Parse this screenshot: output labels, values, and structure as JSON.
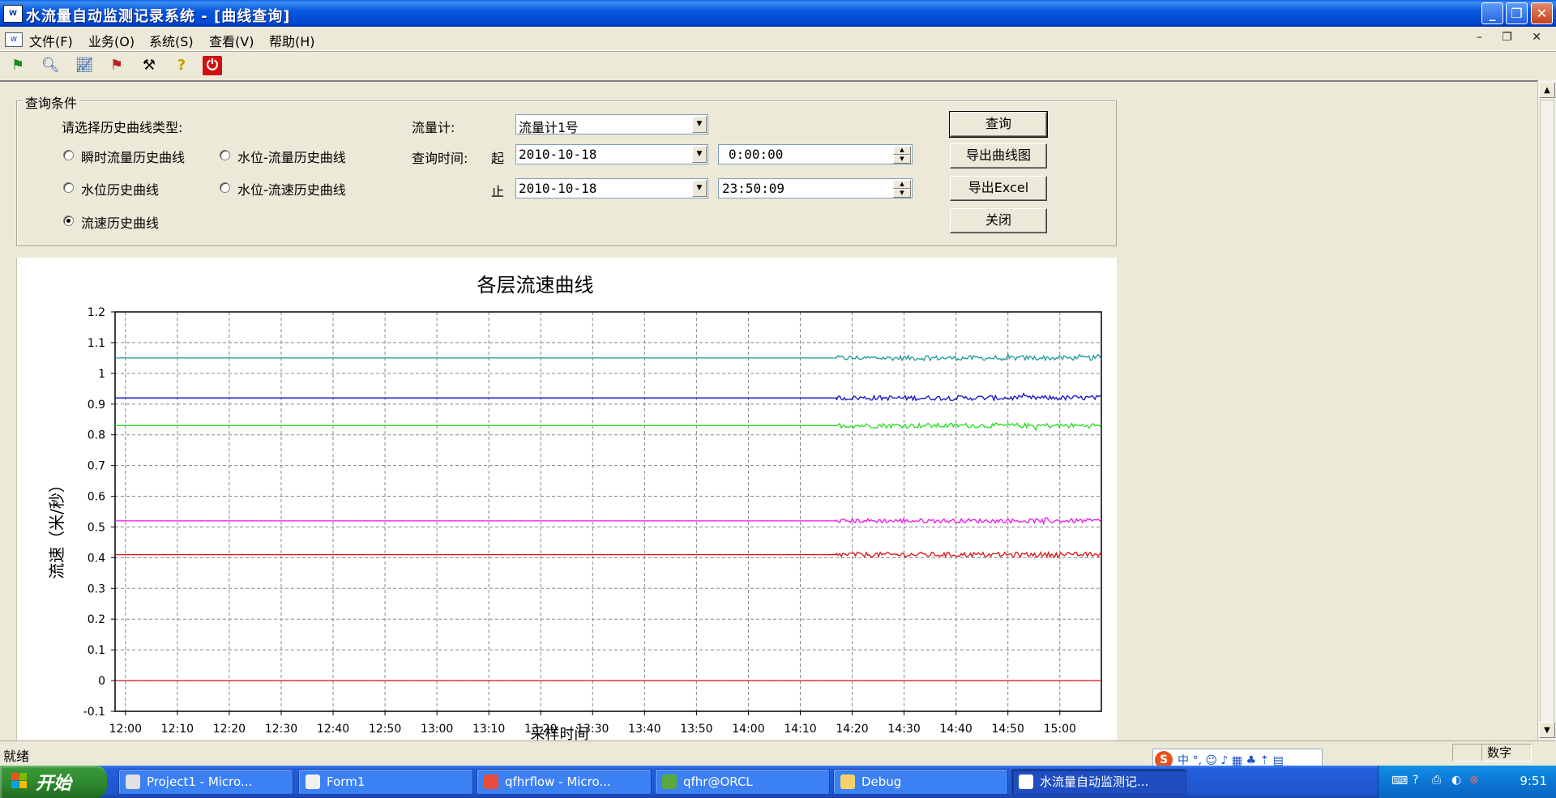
{
  "window": {
    "title": "水流量自动监测记录系统 - [曲线查询]",
    "icon_text": "W"
  },
  "menu": {
    "items": [
      "文件(F)",
      "业务(O)",
      "系统(S)",
      "查看(V)",
      "帮助(H)"
    ]
  },
  "toolbar": {
    "icons": [
      "flag-green-icon",
      "magnifier-icon",
      "chart-icon",
      "flag-red-icon",
      "tools-icon",
      "help-icon",
      "power-icon"
    ]
  },
  "query": {
    "group_label": "查询条件",
    "type_label": "请选择历史曲线类型:",
    "radios": [
      {
        "label": "瞬时流量历史曲线",
        "checked": false
      },
      {
        "label": "水位-流量历史曲线",
        "checked": false
      },
      {
        "label": "水位历史曲线",
        "checked": false
      },
      {
        "label": "水位-流速历史曲线",
        "checked": false
      },
      {
        "label": "流速历史曲线",
        "checked": true
      }
    ],
    "meter_label": "流量计:",
    "meter_value": "流量计1号",
    "time_label": "查询时间:",
    "start_label": "起",
    "end_label": "止",
    "start_date": "2010-10-18",
    "start_time": "0:00:00",
    "end_date": "2010-10-18",
    "end_time": "23:50:09",
    "buttons": {
      "query": "查询",
      "export_chart": "导出曲线图",
      "export_excel": "导出Excel",
      "close": "关闭"
    }
  },
  "chart_data": {
    "type": "line",
    "title": "各层流速曲线",
    "ylabel": "流速（米/秒）",
    "xlabel": "采样时间",
    "ylim": [
      -0.1,
      1.2
    ],
    "yticks": [
      "1.2",
      "1.1",
      "1",
      "0.9",
      "0.8",
      "0.7",
      "0.6",
      "0.5",
      "0.4",
      "0.3",
      "0.2",
      "0.1",
      "0",
      "-0.1"
    ],
    "xticks": [
      "12:00",
      "12:10",
      "12:20",
      "12:30",
      "12:40",
      "12:50",
      "13:00",
      "13:10",
      "13:20",
      "13:30",
      "13:40",
      "13:50",
      "14:00",
      "14:10",
      "14:20",
      "14:30",
      "14:40",
      "14:50",
      "15:00"
    ],
    "grid": true,
    "x_start": "11:58",
    "noise_start": "14:17",
    "x_end": "15:08",
    "series": [
      {
        "color": "#1a9a96",
        "value": 1.05,
        "noise": 0.008
      },
      {
        "color": "#1010c8",
        "value": 0.92,
        "noise": 0.008
      },
      {
        "color": "#22dd22",
        "value": 0.83,
        "noise": 0.008
      },
      {
        "color": "#ee11ee",
        "value": 0.52,
        "noise": 0.007
      },
      {
        "color": "#dd1111",
        "value": 0.41,
        "noise": 0.008
      },
      {
        "color": "#dd1111",
        "value": 0.0,
        "noise": 0
      }
    ]
  },
  "status": {
    "text": "就绪",
    "num_pane": "数字"
  },
  "taskbar": {
    "start_label": "开始",
    "tasks": [
      {
        "label": "Project1 - Micro...",
        "icon_color": "#e0e0e0"
      },
      {
        "label": "Form1",
        "icon_color": "#f0f0f0"
      },
      {
        "label": "qfhrflow - Micro...",
        "icon_color": "#e84c3d"
      },
      {
        "label": "qfhr@ORCL",
        "icon_color": "#58a83c"
      },
      {
        "label": "Debug",
        "icon_color": "#f4d26a"
      },
      {
        "label": "水流量自动监测记...",
        "icon_color": "#ffffff",
        "active": true
      }
    ],
    "clock": "9:51",
    "ime": "中 °, ☺ ♪ ▦ ♣ ⇡ ▤"
  }
}
